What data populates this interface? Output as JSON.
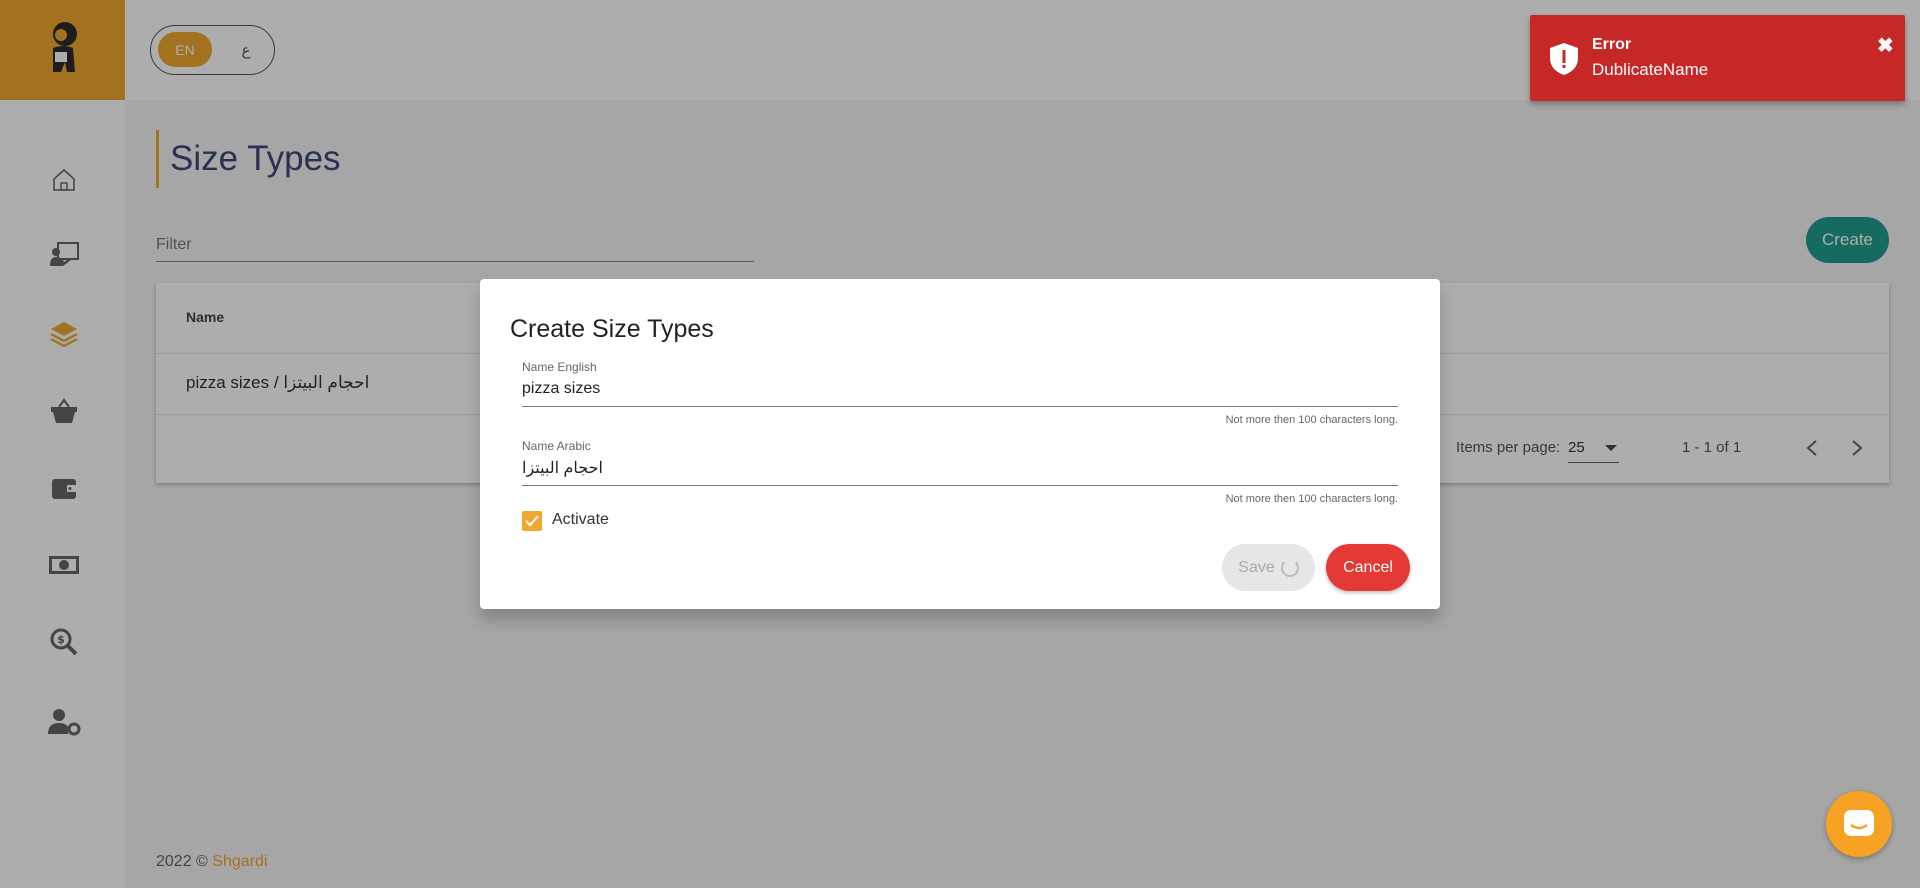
{
  "colors": {
    "accent": "#f0a830",
    "teal": "#1f9e8e",
    "error": "#c62828",
    "cancel": "#e53935",
    "title": "#3f4a7c"
  },
  "app": {
    "logo_icon": "mascot-logo"
  },
  "sidebar": {
    "items": [
      {
        "icon": "home-icon"
      },
      {
        "icon": "presentation-icon"
      },
      {
        "icon": "layers-icon"
      },
      {
        "icon": "basket-icon"
      },
      {
        "icon": "wallet-icon"
      },
      {
        "icon": "money-icon"
      },
      {
        "icon": "search-dollar-icon"
      },
      {
        "icon": "user-settings-icon"
      }
    ]
  },
  "header": {
    "lang_en": "EN",
    "lang_ar": "ع"
  },
  "page": {
    "title": "Size Types",
    "filter_label": "Filter",
    "create_label": "Create"
  },
  "table": {
    "columns": [
      "Name"
    ],
    "rows": [
      {
        "name": "pizza sizes / احجام البيتزا"
      }
    ],
    "items_per_page_label": "Items per page:",
    "items_per_page": "25",
    "range": "1 - 1 of 1"
  },
  "footer": {
    "text": "2022 © ",
    "brand": "Shgardi"
  },
  "toast": {
    "title": "Error",
    "message": "DublicateName",
    "close": "✖"
  },
  "dialog": {
    "title": "Create Size Types",
    "name_english": {
      "label": "Name English",
      "value": "pizza sizes",
      "hint": "Not more then 100 characters long."
    },
    "name_arabic": {
      "label": "Name Arabic",
      "value": "احجام البيتزا",
      "hint": "Not more then 100 characters long."
    },
    "activate_label": "Activate",
    "activate_checked": true,
    "save_label": "Save",
    "cancel_label": "Cancel"
  }
}
